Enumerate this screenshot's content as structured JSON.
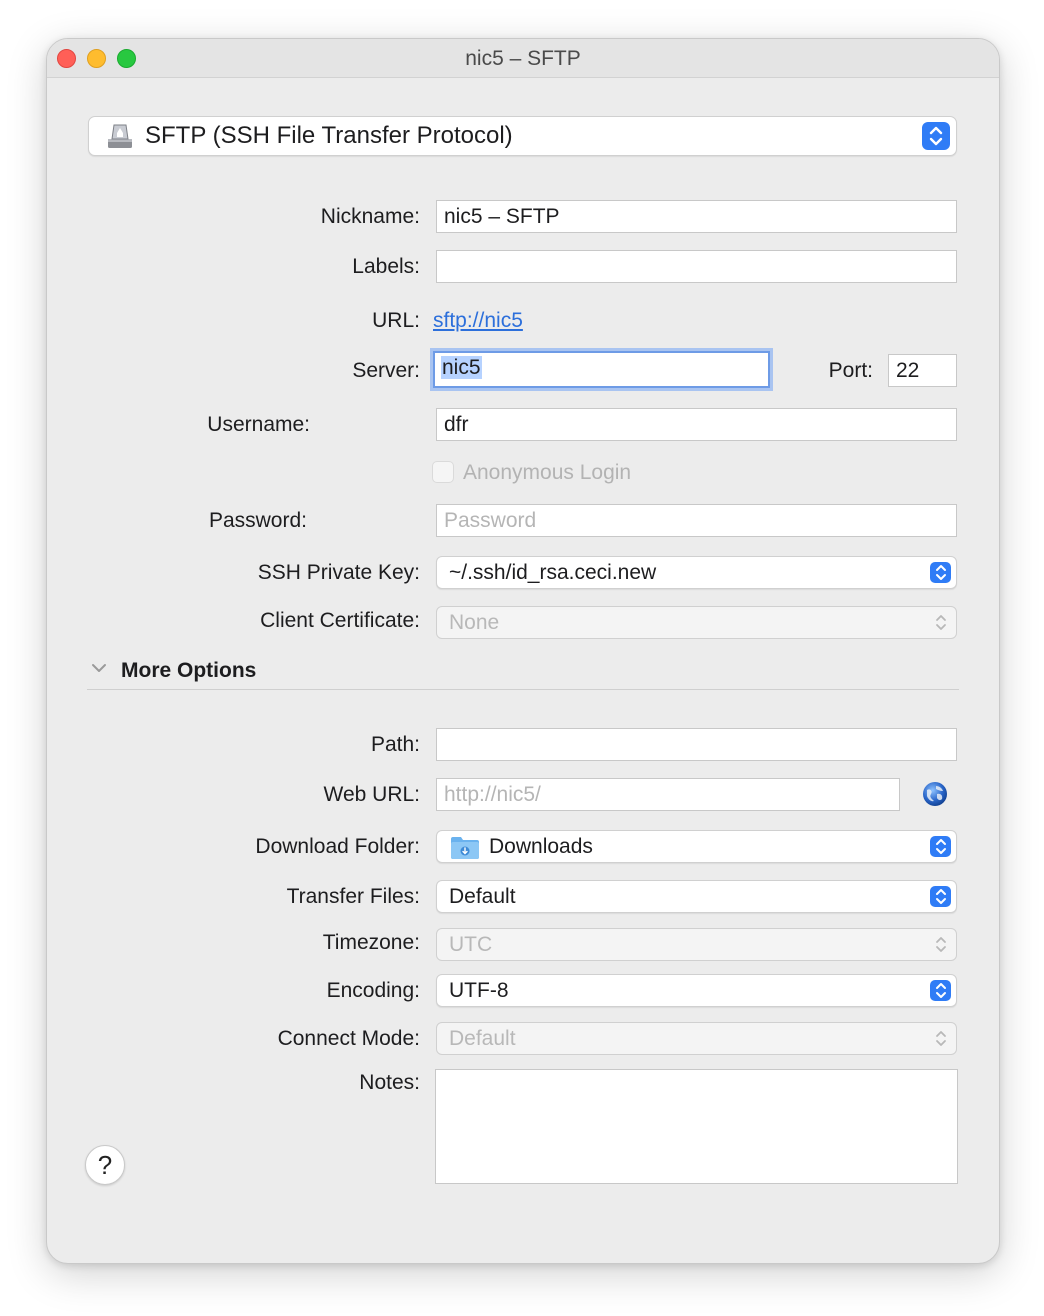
{
  "window": {
    "title": "nic5 – SFTP"
  },
  "protocol": {
    "label": "SFTP (SSH File Transfer Protocol)"
  },
  "fields": {
    "nickname": {
      "label": "Nickname:",
      "value": "nic5 – SFTP"
    },
    "labels": {
      "label": "Labels:",
      "value": ""
    },
    "url": {
      "label": "URL:",
      "value": "sftp://nic5"
    },
    "server": {
      "label": "Server:",
      "value": "nic5"
    },
    "port": {
      "label": "Port:",
      "value": "22"
    },
    "username": {
      "label": "Username:",
      "value": "dfr"
    },
    "anonymous": {
      "label": "Anonymous Login",
      "checked": false
    },
    "password": {
      "label": "Password:",
      "placeholder": "Password"
    },
    "ssh_key": {
      "label": "SSH Private Key:",
      "value": "~/.ssh/id_rsa.ceci.new"
    },
    "client_cert": {
      "label": "Client Certificate:",
      "value": "None"
    }
  },
  "more_options": {
    "title": "More Options",
    "path": {
      "label": "Path:",
      "value": ""
    },
    "web_url": {
      "label": "Web URL:",
      "placeholder": "http://nic5/"
    },
    "download_folder": {
      "label": "Download Folder:",
      "value": "Downloads"
    },
    "transfer_files": {
      "label": "Transfer Files:",
      "value": "Default"
    },
    "timezone": {
      "label": "Timezone:",
      "value": "UTC"
    },
    "encoding": {
      "label": "Encoding:",
      "value": "UTF-8"
    },
    "connect_mode": {
      "label": "Connect Mode:",
      "value": "Default"
    },
    "notes": {
      "label": "Notes:",
      "value": ""
    }
  },
  "help": {
    "label": "?"
  },
  "colors": {
    "accent": "#2f7cf6",
    "arrow": "#e8432e",
    "link": "#2c6fdb"
  }
}
